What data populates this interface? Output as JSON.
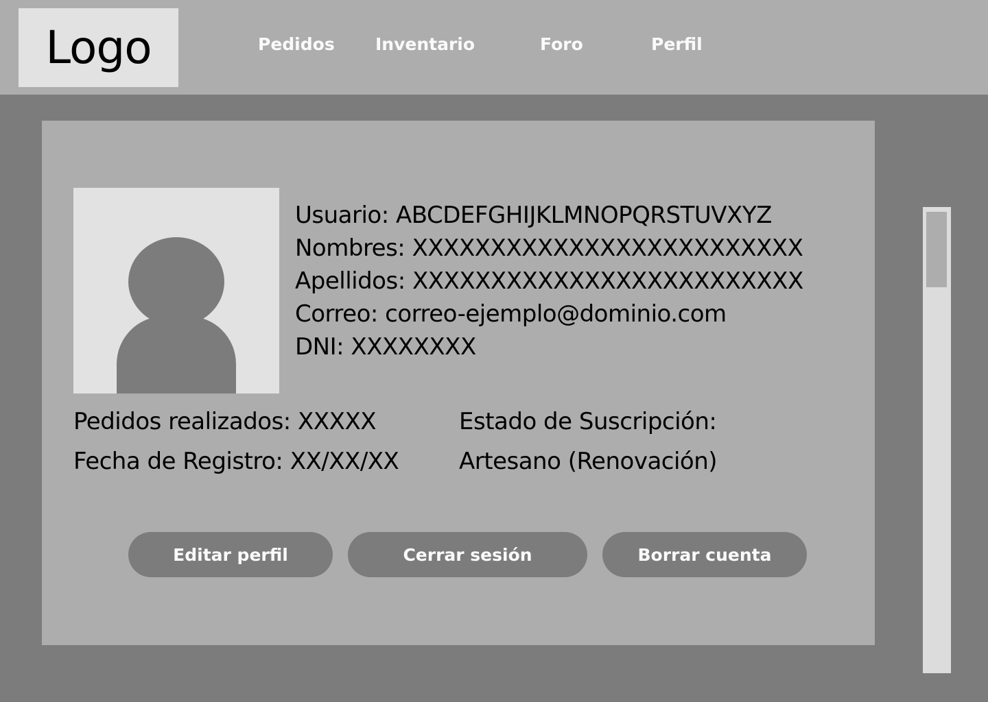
{
  "header": {
    "logo": "Logo",
    "nav": [
      {
        "label": "Pedidos"
      },
      {
        "label": "Inventario"
      },
      {
        "label": "Foro"
      },
      {
        "label": "Perfil"
      }
    ]
  },
  "profile": {
    "usuario": "Usuario: ABCDEFGHIJKLMNOPQRSTUVXYZ",
    "nombres": "Nombres: XXXXXXXXXXXXXXXXXXXXXXXXX",
    "apellidos": "Apellidos: XXXXXXXXXXXXXXXXXXXXXXXXX",
    "correo": "Correo: correo-ejemplo@dominio.com",
    "dni": "DNI: XXXXXXXX",
    "pedidos": "Pedidos realizados: XXXXX",
    "fecha": "Fecha de Registro: XX/XX/XX",
    "estado_label": "Estado de Suscripción:",
    "estado_value": "Artesano (Renovación)"
  },
  "actions": {
    "edit": "Editar perfil",
    "logout": "Cerrar sesión",
    "delete": "Borrar cuenta"
  },
  "colors": {
    "background": "#7c7c7c",
    "panel": "#adadad",
    "light": "#e2e2e2",
    "button_text": "#fafafa"
  }
}
